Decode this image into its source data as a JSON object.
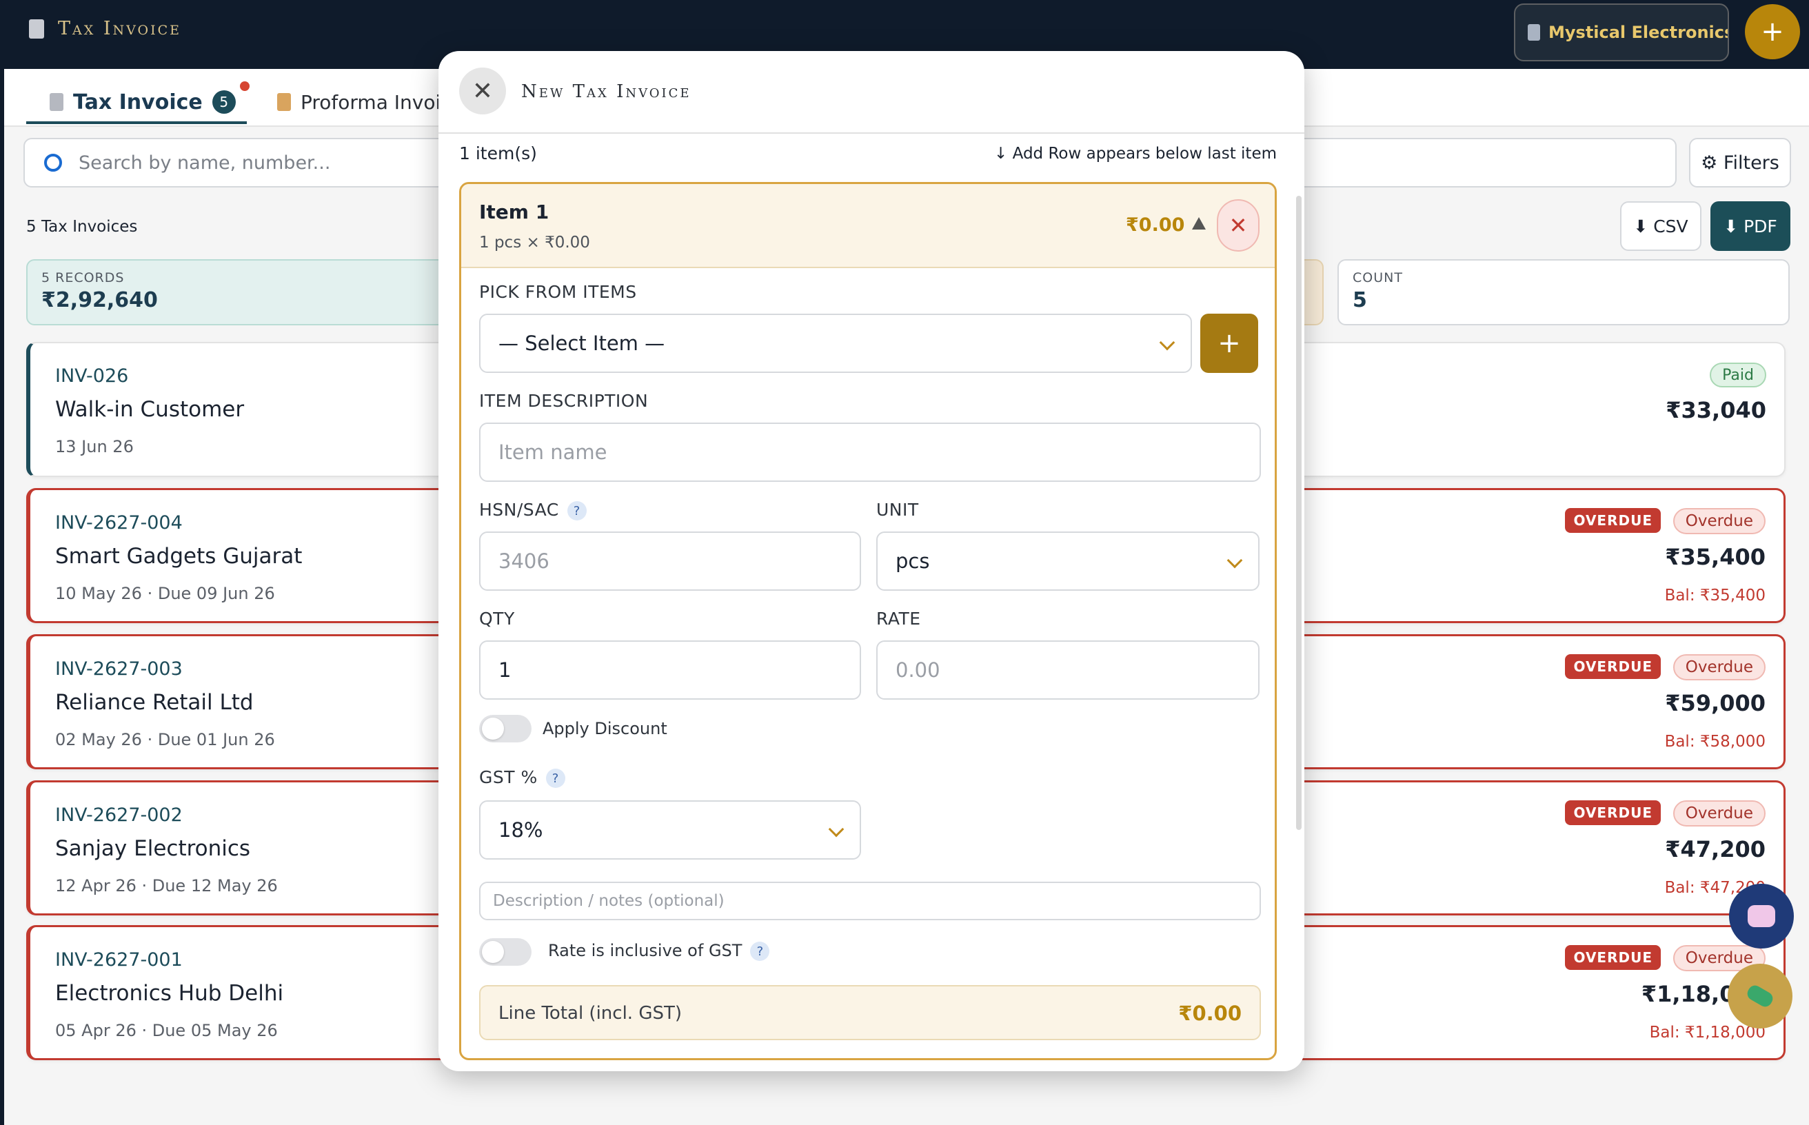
{
  "header": {
    "app_title": "Tax Invoice",
    "company_name": "Mystical Electronics Tra",
    "add_symbol": "+"
  },
  "tabs": [
    {
      "label": "Tax Invoice",
      "count": "5",
      "active": true
    },
    {
      "label": "Proforma Invoice",
      "active": false
    }
  ],
  "search": {
    "placeholder": "Search by name, number..."
  },
  "toolbar": {
    "filters_label": "⚙ Filters",
    "invoice_count_text": "5 Tax Invoices",
    "csv_label": "⬇ CSV",
    "pdf_label": "⬇ PDF"
  },
  "summary": {
    "records_label": "5 RECORDS",
    "records_value": "₹2,92,640",
    "count_label": "COUNT",
    "count_value": "5"
  },
  "invoices": [
    {
      "number": "INV-026",
      "customer": "Walk-in Customer",
      "date": "13 Jun 26",
      "amount": "₹33,040",
      "status": "Paid",
      "balance": ""
    },
    {
      "number": "INV-2627-004",
      "customer": "Smart Gadgets Gujarat",
      "date": "10 May 26 · Due 09 Jun 26",
      "amount": "₹35,400",
      "status": "Overdue",
      "tag": "OVERDUE",
      "balance": "Bal: ₹35,400"
    },
    {
      "number": "INV-2627-003",
      "customer": "Reliance Retail Ltd",
      "date": "02 May 26 · Due 01 Jun 26",
      "amount": "₹59,000",
      "status": "Overdue",
      "tag": "OVERDUE",
      "balance": "Bal: ₹58,000"
    },
    {
      "number": "INV-2627-002",
      "customer": "Sanjay Electronics",
      "date": "12 Apr 26 · Due 12 May 26",
      "amount": "₹47,200",
      "status": "Overdue",
      "tag": "OVERDUE",
      "balance": "Bal: ₹47,200"
    },
    {
      "number": "INV-2627-001",
      "customer": "Electronics Hub Delhi",
      "date": "05 Apr 26 · Due 05 May 26",
      "amount": "₹1,18,000",
      "status": "Overdue",
      "tag": "OVERDUE",
      "balance": "Bal: ₹1,18,000"
    }
  ],
  "modal": {
    "title": "New Tax Invoice",
    "close_symbol": "✕",
    "items_count": "1 item(s)",
    "add_row_hint": "↓ Add Row appears below last item",
    "item": {
      "title": "Item 1",
      "summary": "1 pcs × ₹0.00",
      "total": "₹0.00",
      "remove_symbol": "✕",
      "pick_label": "PICK FROM ITEMS",
      "select_value": "— Select Item —",
      "add_symbol": "+",
      "desc_label": "ITEM DESCRIPTION",
      "desc_placeholder": "Item name",
      "hsn_label": "HSN/SAC",
      "hsn_placeholder": "3406",
      "unit_label": "UNIT",
      "unit_value": "pcs",
      "qty_label": "QTY",
      "qty_value": "1",
      "rate_label": "RATE",
      "rate_placeholder": "0.00",
      "discount_label": "Apply Discount",
      "gst_label": "GST %",
      "gst_value": "18%",
      "notes_placeholder": "Description / notes (optional)",
      "inclusive_label": "Rate is inclusive of GST",
      "help_symbol": "?",
      "line_total_label": "Line Total (incl. GST)",
      "line_total_value": "₹0.00"
    }
  },
  "colors": {
    "header_bg": "#0f1b2b",
    "accent_gold": "#b8860b",
    "teal": "#1d4c5a",
    "overdue_red": "#c23a30",
    "paid_green": "#2c7a45"
  }
}
